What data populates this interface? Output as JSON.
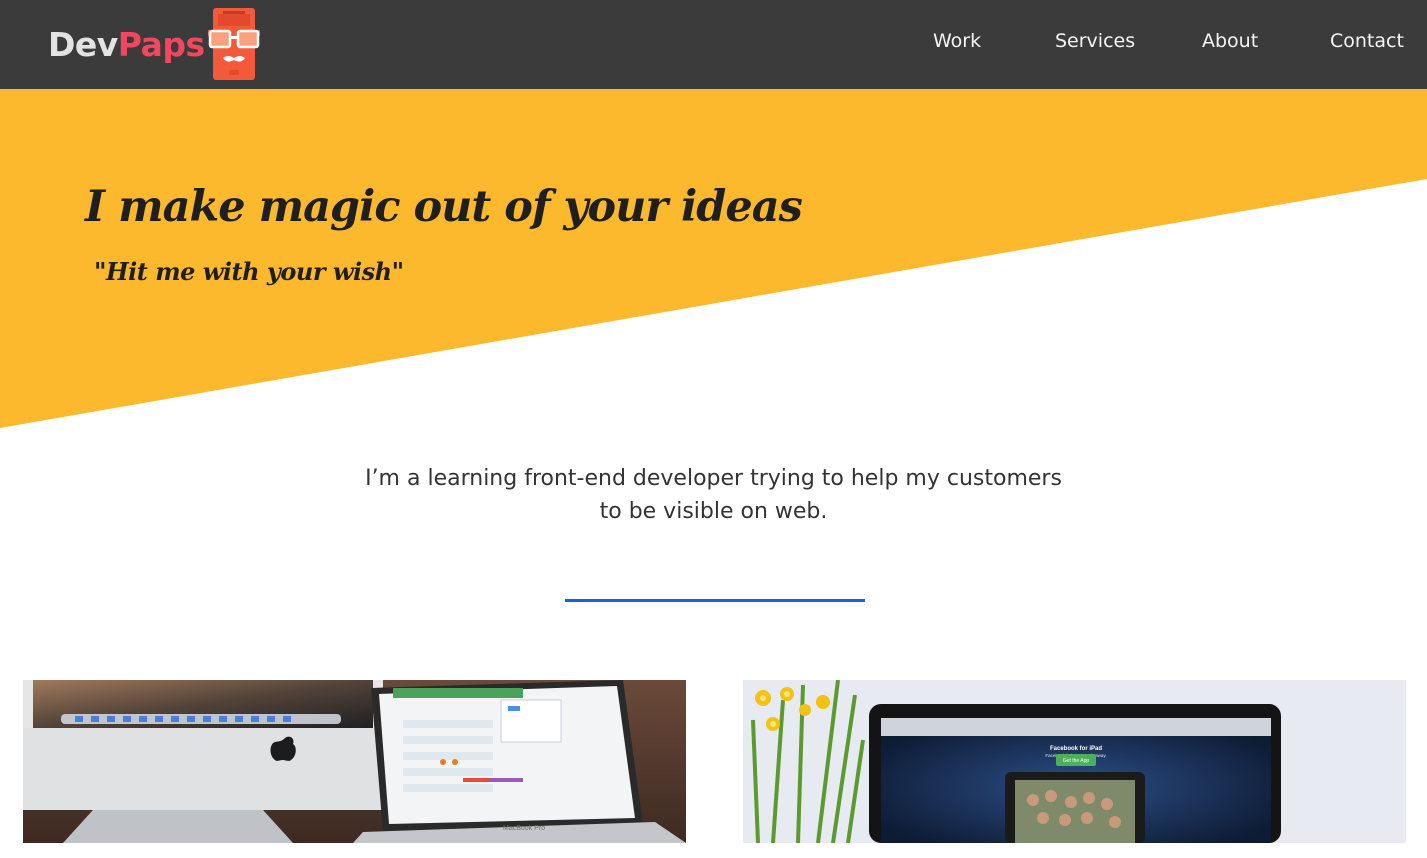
{
  "nav": {
    "logo": {
      "part1": "Dev",
      "part2": "Paps"
    },
    "links": [
      "Work",
      "Services",
      "About",
      "Contact"
    ]
  },
  "hero": {
    "title": "I make magic out of your ideas",
    "subtitle": "\"Hit me with your wish\""
  },
  "intro": {
    "line1": "I’m a learning front-end developer trying to help my customers",
    "line2": "to be visible on web."
  },
  "cards": [
    {
      "image": "imac-macbook-calendar-photo",
      "screen_text": "MacBook Pro"
    },
    {
      "image": "laptop-facebook-for-ipad-photo",
      "screen_title": "Facebook for iPad",
      "screen_tagline": "Facebook is just a touch away.",
      "screen_button": "Get the App"
    }
  ],
  "colors": {
    "nav_bg": "#3b3b3b",
    "accent_yellow": "#fdb92e",
    "logo_red": "#f2475e",
    "divider_blue": "#1a63d6"
  }
}
